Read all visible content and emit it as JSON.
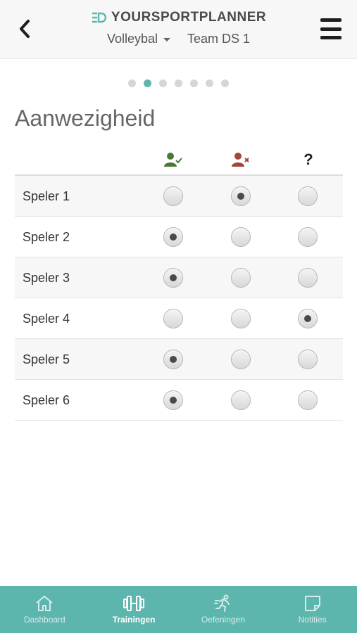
{
  "header": {
    "brand_prefix": "YOUR",
    "brand_suffix": "SPORTPLANNER",
    "sport": "Volleybal",
    "team": "Team DS 1",
    "colors": {
      "accent": "#5db6ae",
      "brand_text": "#4a4a4a"
    }
  },
  "pager": {
    "count": 7,
    "active_index": 1
  },
  "main": {
    "title": "Aanwezigheid",
    "columns": [
      {
        "icon": "user-present-icon",
        "color": "#4a7a3a"
      },
      {
        "icon": "user-absent-icon",
        "color": "#a0473a"
      },
      {
        "icon": "question-icon",
        "label": "?"
      }
    ],
    "players": [
      {
        "name": "Speler 1",
        "status": "absent"
      },
      {
        "name": "Speler 2",
        "status": "present"
      },
      {
        "name": "Speler 3",
        "status": "present"
      },
      {
        "name": "Speler 4",
        "status": "unknown"
      },
      {
        "name": "Speler 5",
        "status": "present"
      },
      {
        "name": "Speler 6",
        "status": "present"
      }
    ]
  },
  "bottom_nav": {
    "items": [
      {
        "label": "Dashboard",
        "icon": "home-icon",
        "active": false
      },
      {
        "label": "Trainingen",
        "icon": "dumbbell-icon",
        "active": true
      },
      {
        "label": "Oefeningen",
        "icon": "running-icon",
        "active": false
      },
      {
        "label": "Notities",
        "icon": "note-icon",
        "active": false
      }
    ]
  }
}
